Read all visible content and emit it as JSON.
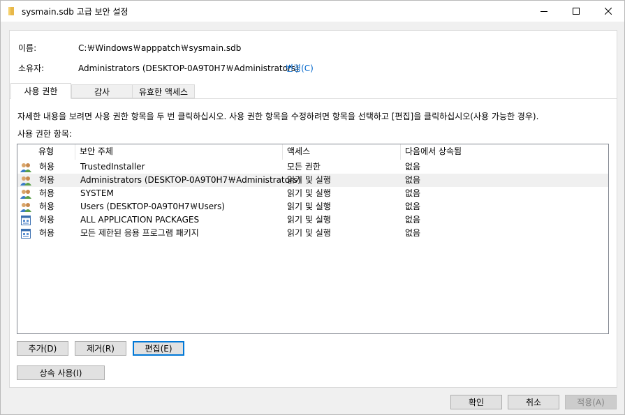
{
  "window": {
    "title": "sysmain.sdb 고급 보안 설정"
  },
  "info": {
    "name_label": "이름:",
    "name_value": "C:￦Windows￦apppatch￦sysmain.sdb",
    "owner_label": "소유자:",
    "owner_value": "Administrators (DESKTOP-0A9T0H7￦Administrators)",
    "change_link": "변경(C)"
  },
  "tabs": [
    {
      "label": "사용 권한",
      "active": true
    },
    {
      "label": "감사",
      "active": false
    },
    {
      "label": "유효한 액세스",
      "active": false
    }
  ],
  "instructions": "자세한 내용을 보려면 사용 권한 항목을 두 번 클릭하십시오. 사용 권한 항목을 수정하려면 항목을 선택하고 [편집]을 클릭하십시오(사용 가능한 경우).",
  "entries_label": "사용 권한 항목:",
  "table": {
    "columns": [
      "유형",
      "보안 주체",
      "액세스",
      "다음에서 상속됨"
    ],
    "rows": [
      {
        "icon": "users-group-icon",
        "type": "허용",
        "principal": "TrustedInstaller",
        "access": "모든 권한",
        "inherited": "없음"
      },
      {
        "icon": "users-group-icon",
        "type": "허용",
        "principal": "Administrators (DESKTOP-0A9T0H7￦Administrators)",
        "access": "읽기 및 실행",
        "inherited": "없음"
      },
      {
        "icon": "users-group-icon",
        "type": "허용",
        "principal": "SYSTEM",
        "access": "읽기 및 실행",
        "inherited": "없음"
      },
      {
        "icon": "users-group-icon",
        "type": "허용",
        "principal": "Users (DESKTOP-0A9T0H7￦Users)",
        "access": "읽기 및 실행",
        "inherited": "없음"
      },
      {
        "icon": "app-package-icon",
        "type": "허용",
        "principal": "ALL APPLICATION PACKAGES",
        "access": "읽기 및 실행",
        "inherited": "없음"
      },
      {
        "icon": "app-package-icon",
        "type": "허용",
        "principal": "모든 제한된 응용 프로그램 패키지",
        "access": "읽기 및 실행",
        "inherited": "없음"
      }
    ]
  },
  "buttons": {
    "add": "추가(D)",
    "remove": "제거(R)",
    "edit": "편집(E)",
    "inheritance": "상속 사용(I)",
    "ok": "확인",
    "cancel": "취소",
    "apply": "적용(A)"
  }
}
